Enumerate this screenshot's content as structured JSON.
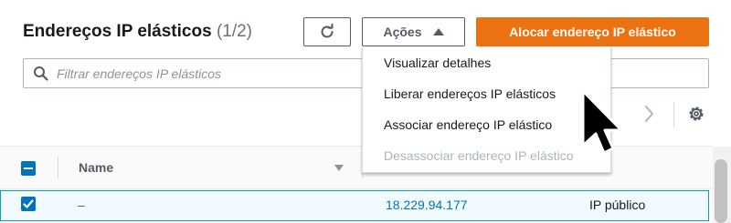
{
  "header": {
    "title": "Endereços IP elásticos",
    "count": "(1/2)",
    "actions_label": "Ações",
    "allocate_label": "Alocar endereço IP elástico"
  },
  "search": {
    "placeholder": "Filtrar endereços IP elásticos"
  },
  "table": {
    "columns": {
      "name": "Name",
      "type_partial": "o"
    },
    "rows": [
      {
        "name": "–",
        "ip": "18.229.94.177",
        "type": "IP público",
        "selected": true
      }
    ]
  },
  "actions_menu": {
    "items": [
      {
        "label": "Visualizar detalhes",
        "disabled": false
      },
      {
        "label": "Liberar endereços IP elásticos",
        "disabled": false
      },
      {
        "label": "Associar endereço IP elástico",
        "disabled": false
      },
      {
        "label": "Desassociar endereço IP elástico",
        "disabled": true
      }
    ]
  },
  "colors": {
    "primary": "#ec7211",
    "link": "#0073bb",
    "selected_row_bg": "#f1faff",
    "selected_row_border": "#00a1c9"
  },
  "icons": [
    "refresh-icon",
    "caret-up-icon",
    "search-icon",
    "chevron-right-icon",
    "gear-icon",
    "sort-down-icon",
    "mouse-pointer-icon"
  ]
}
